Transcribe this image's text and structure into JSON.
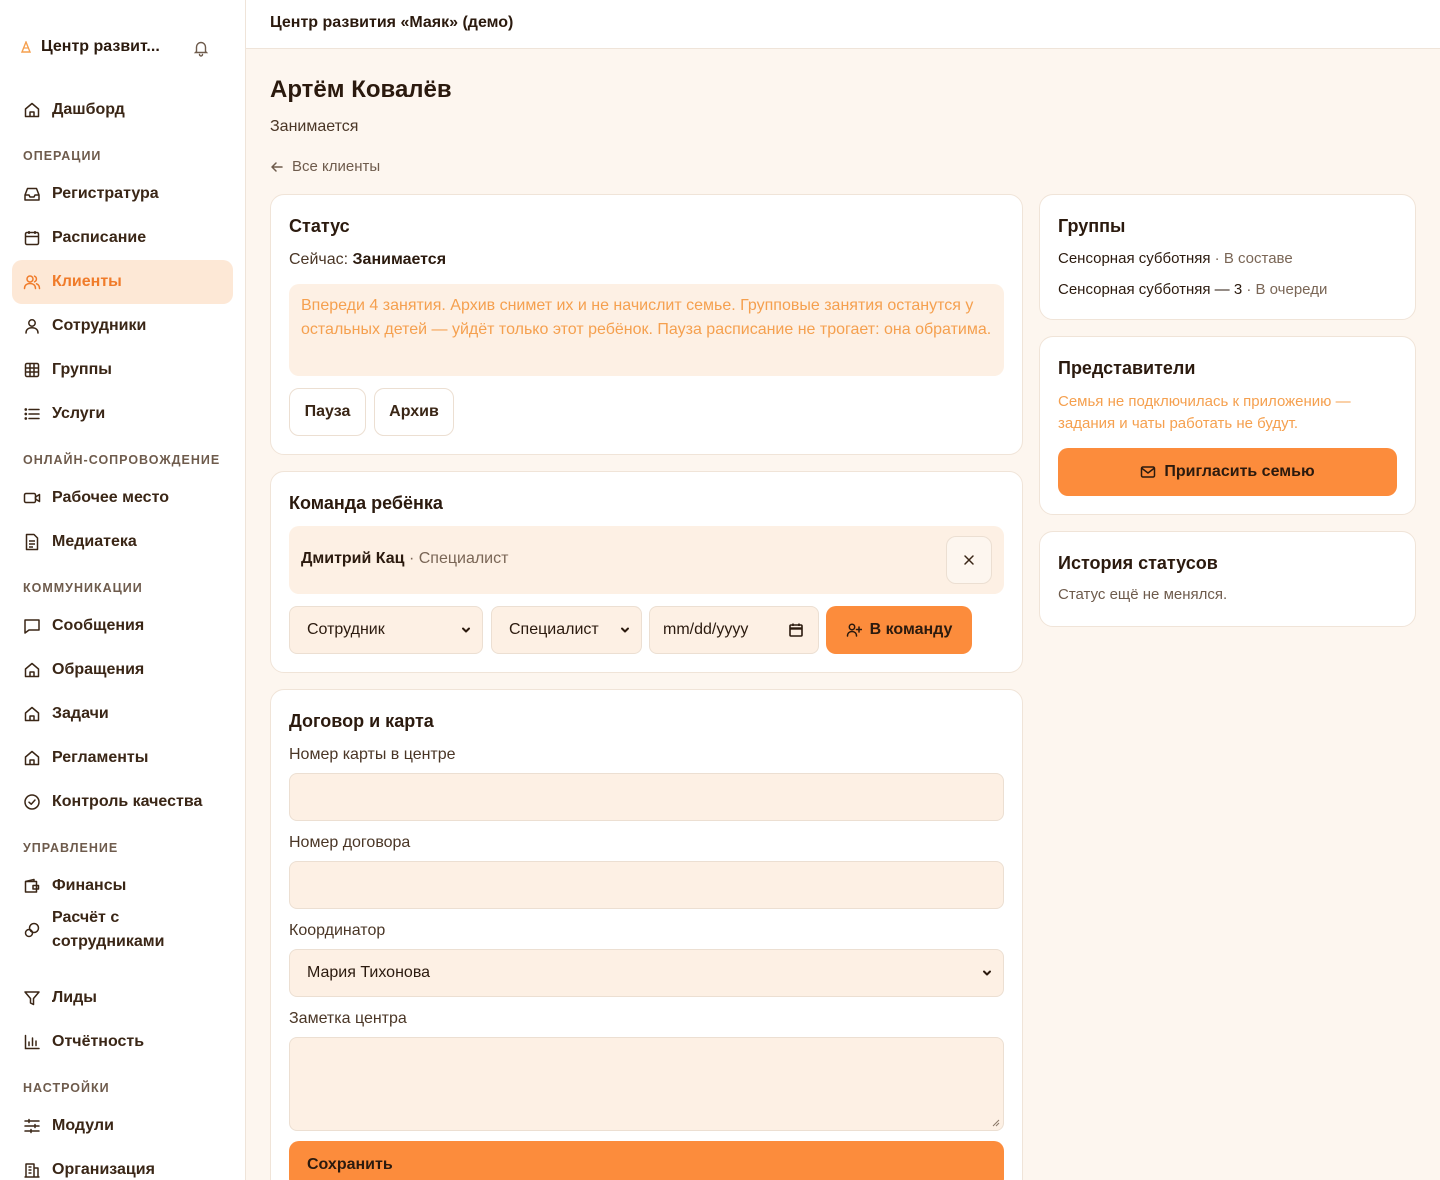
{
  "sidebar": {
    "org_name": "Центр развит...",
    "items": [
      {
        "label": "Дашборд",
        "icon": "home-icon"
      },
      {
        "label": "Регистратура",
        "icon": "inbox-icon"
      },
      {
        "label": "Расписание",
        "icon": "calendar-icon"
      },
      {
        "label": "Клиенты",
        "icon": "users-icon",
        "active": true
      },
      {
        "label": "Сотрудники",
        "icon": "user-icon"
      },
      {
        "label": "Группы",
        "icon": "grid-icon"
      },
      {
        "label": "Услуги",
        "icon": "list-icon"
      },
      {
        "label": "Рабочее место",
        "icon": "video-icon"
      },
      {
        "label": "Медиатека",
        "icon": "file-icon"
      },
      {
        "label": "Сообщения",
        "icon": "message-icon"
      },
      {
        "label": "Обращения",
        "icon": "home-icon"
      },
      {
        "label": "Задачи",
        "icon": "home-icon"
      },
      {
        "label": "Регламенты",
        "icon": "home-icon"
      },
      {
        "label": "Контроль качества",
        "icon": "check-circle-icon"
      },
      {
        "label": "Финансы",
        "icon": "wallet-icon"
      },
      {
        "label": "Расчёт с",
        "label2": "сотрудниками",
        "icon": "coins-icon"
      },
      {
        "label": "Лиды",
        "icon": "filter-icon"
      },
      {
        "label": "Отчётность",
        "icon": "bar-chart-icon"
      },
      {
        "label": "Модули",
        "icon": "sliders-icon"
      },
      {
        "label": "Организация",
        "icon": "building-icon"
      }
    ],
    "sections": {
      "operations": "ОПЕРАЦИИ",
      "online": "ОНЛАЙН-СОПРОВОЖДЕНИЕ",
      "communications": "КОММУНИКАЦИИ",
      "management": "УПРАВЛЕНИЕ",
      "settings": "НАСТРОЙКИ"
    }
  },
  "topbar": {
    "title": "Центр развития «Маяк» (демо)"
  },
  "client": {
    "name": "Артём Ковалёв",
    "status": "Занимается",
    "back_label": "Все клиенты"
  },
  "status_card": {
    "title": "Статус",
    "now_prefix": "Сейчас:",
    "now_value": "Занимается",
    "warning": "Впереди 4 занятия. Архив снимет их и не начислит семье. Групповые занятия останутся у остальных детей — уйдёт только этот ребёнок. Пауза расписание не трогает: она обратима.",
    "pause_label": "Пауза",
    "archive_label": "Архив"
  },
  "team_card": {
    "title": "Команда ребёнка",
    "member_name": "Дмитрий Кац",
    "member_sep": " · ",
    "member_role": "Специалист",
    "employee_select": "Сотрудник",
    "role_select": "Специалист",
    "date_placeholder": "mm/dd/yyyy",
    "add_label": "В команду"
  },
  "contract_card": {
    "title": "Договор и карта",
    "card_number_label": "Номер карты в центре",
    "card_number_value": "",
    "contract_number_label": "Номер договора",
    "contract_number_value": "",
    "coordinator_label": "Координатор",
    "coordinator_value": "Мария Тихонова",
    "note_label": "Заметка центра",
    "note_value": "",
    "save_label": "Сохранить"
  },
  "groups_card": {
    "title": "Группы",
    "items": [
      {
        "name": "Сенсорная субботняя",
        "state": " · В составе"
      },
      {
        "name": "Сенсорная субботняя — 3",
        "state": " · В очереди"
      }
    ]
  },
  "reps_card": {
    "title": "Представители",
    "note": "Семья не подключилась к приложению — задания и чаты работать не будут.",
    "invite_label": "Пригласить семью"
  },
  "history_card": {
    "title": "История статусов",
    "note": "Статус ещё не менялся."
  },
  "colors": {
    "accent": "#fc8c3c",
    "accent_text": "#f07b2a",
    "warning_text": "#f5a04f",
    "field_bg": "#fdf0e4",
    "page_bg": "#fdf6ef"
  }
}
